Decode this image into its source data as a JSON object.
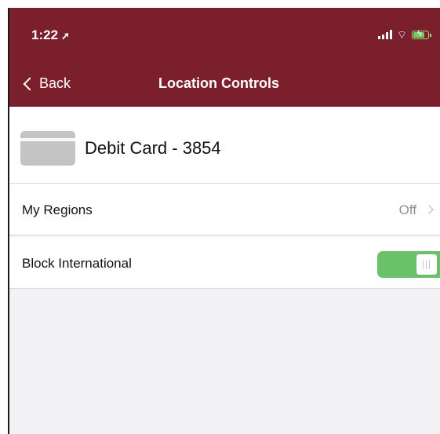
{
  "status_bar": {
    "time": "1:22",
    "location_arrow_icon": "location-arrow-icon",
    "icons": [
      "signal-bars-icon",
      "wifi-icon",
      "battery-charging-icon"
    ]
  },
  "nav": {
    "back_label": "Back",
    "title": "Location Controls"
  },
  "card": {
    "label": "Debit Card - 3854",
    "icon": "credit-card-icon"
  },
  "rows": {
    "my_regions": {
      "label": "My Regions",
      "value": "Off"
    },
    "block_international": {
      "label": "Block International",
      "toggle_on": true
    }
  },
  "colors": {
    "header_bg": "#7a1f2b",
    "toggle_on": "#6bc26a",
    "list_bg": "#f2f2f4"
  }
}
